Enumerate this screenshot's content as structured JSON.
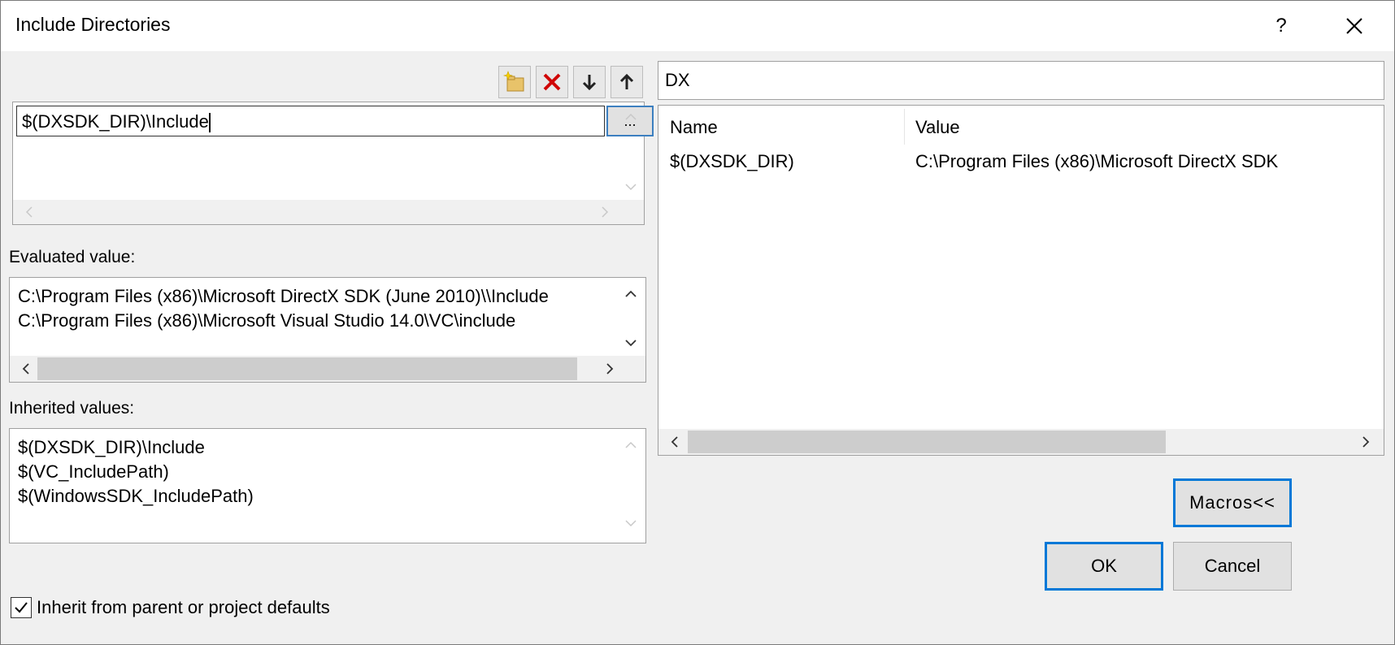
{
  "window": {
    "title": "Include Directories",
    "help_label": "?"
  },
  "toolbar": {
    "icons": [
      "new-line-icon",
      "delete-icon",
      "move-down-icon",
      "move-up-icon"
    ]
  },
  "editor": {
    "value": "$(DXSDK_DIR)\\Include",
    "browse_label": "..."
  },
  "evaluated": {
    "label": "Evaluated value:",
    "lines": [
      "C:\\Program Files (x86)\\Microsoft DirectX SDK (June 2010)\\\\Include",
      "C:\\Program Files (x86)\\Microsoft Visual Studio 14.0\\VC\\include"
    ]
  },
  "inherited": {
    "label": "Inherited values:",
    "lines": [
      "$(DXSDK_DIR)\\Include",
      "$(VC_IncludePath)",
      "$(WindowsSDK_IncludePath)"
    ]
  },
  "inherit_checkbox": {
    "label": "Inherit from parent or project defaults",
    "checked": true
  },
  "macro_search": {
    "value": "DX"
  },
  "macros_table": {
    "columns": [
      "Name",
      "Value"
    ],
    "rows": [
      [
        "$(DXSDK_DIR)",
        "C:\\Program Files (x86)\\Microsoft DirectX SDK"
      ]
    ]
  },
  "buttons": {
    "macros": "Macros<<",
    "ok": "OK",
    "cancel": "Cancel"
  },
  "colors": {
    "accent": "#0078d7",
    "delete_red": "#d00000"
  }
}
